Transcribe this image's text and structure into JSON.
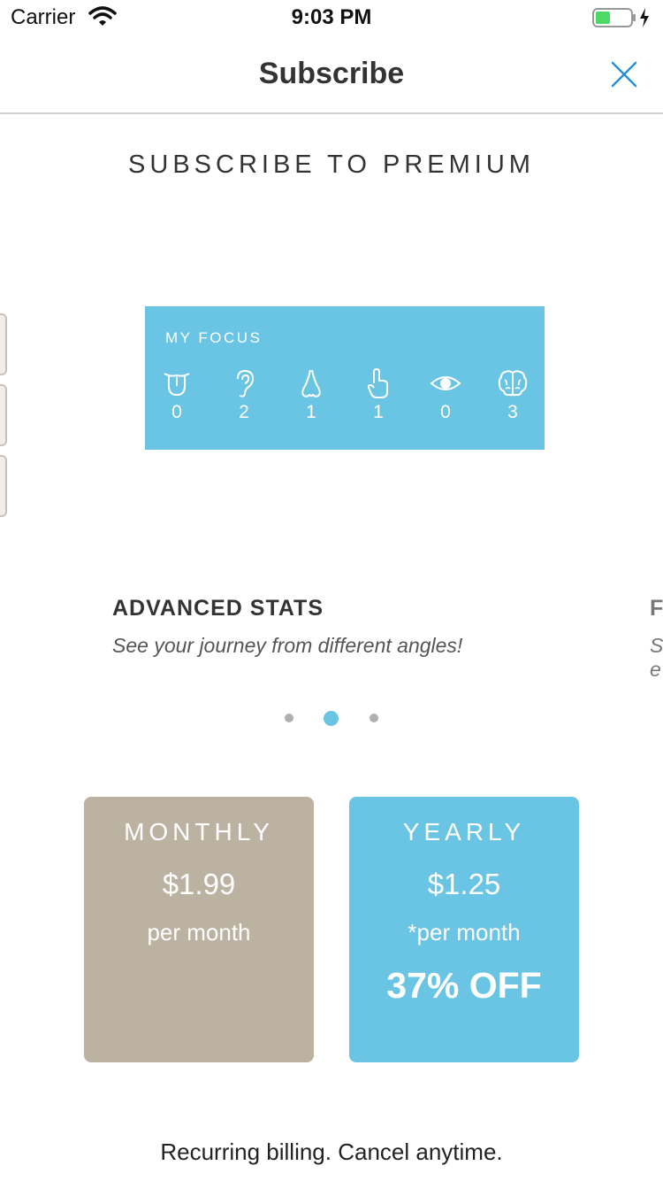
{
  "status_bar": {
    "carrier": "Carrier",
    "time": "9:03 PM",
    "battery_color": "#4cd964"
  },
  "nav": {
    "title": "Subscribe",
    "close_icon": "close-icon",
    "accent_color": "#2a8fd8"
  },
  "heading": "SUBSCRIBE TO PREMIUM",
  "focus_card": {
    "label": "MY FOCUS",
    "background": "#6ac4e4",
    "senses": [
      {
        "icon": "tongue-icon",
        "count": "0"
      },
      {
        "icon": "ear-icon",
        "count": "2"
      },
      {
        "icon": "nose-icon",
        "count": "1"
      },
      {
        "icon": "hand-icon",
        "count": "1"
      },
      {
        "icon": "eye-icon",
        "count": "0"
      },
      {
        "icon": "brain-icon",
        "count": "3"
      }
    ]
  },
  "feature": {
    "title": "ADVANCED STATS",
    "description": "See your journey from different angles!"
  },
  "next_feature_peek": {
    "title": "F",
    "desc_line1": "S",
    "desc_line2": "e"
  },
  "pager": {
    "count": 3,
    "active_index": 1,
    "active_color": "#6ac4e4",
    "inactive_color": "#b0b0b0"
  },
  "plans": {
    "monthly": {
      "name": "MONTHLY",
      "price": "$1.99",
      "period": "per month",
      "color": "#bbb2a2"
    },
    "yearly": {
      "name": "YEARLY",
      "price": "$1.25",
      "period": "*per month",
      "discount": "37% OFF",
      "color": "#6ac4e4"
    }
  },
  "footer": "Recurring billing. Cancel anytime."
}
